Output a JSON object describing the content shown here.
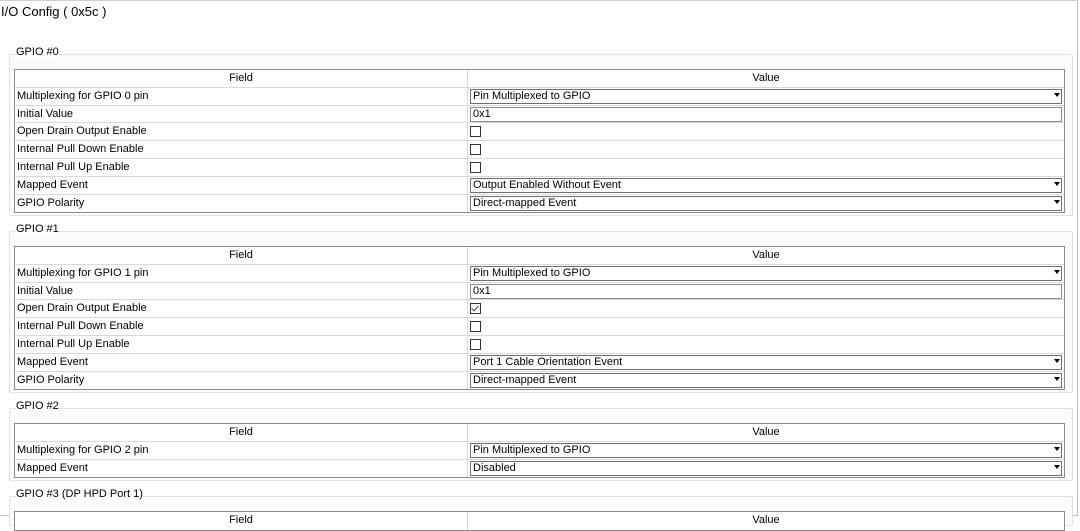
{
  "page": {
    "title": "I/O Config  ( 0x5c )"
  },
  "table_header": {
    "field": "Field",
    "value": "Value"
  },
  "gpio0": {
    "title": "GPIO #0",
    "rows": [
      {
        "label": "Multiplexing for GPIO 0 pin",
        "type": "select",
        "value": "Pin Multiplexed to GPIO"
      },
      {
        "label": "Initial Value",
        "type": "text",
        "value": "0x1"
      },
      {
        "label": "Open Drain Output Enable",
        "type": "checkbox",
        "checked": false
      },
      {
        "label": "Internal Pull Down Enable",
        "type": "checkbox",
        "checked": false
      },
      {
        "label": "Internal Pull Up Enable",
        "type": "checkbox",
        "checked": false
      },
      {
        "label": "Mapped Event",
        "type": "select",
        "value": "Output Enabled Without Event"
      },
      {
        "label": "GPIO Polarity",
        "type": "select",
        "value": "Direct-mapped Event"
      }
    ]
  },
  "gpio1": {
    "title": "GPIO #1",
    "rows": [
      {
        "label": "Multiplexing for GPIO 1 pin",
        "type": "select",
        "value": "Pin Multiplexed to GPIO"
      },
      {
        "label": "Initial Value",
        "type": "text",
        "value": "0x1"
      },
      {
        "label": "Open Drain Output Enable",
        "type": "checkbox",
        "checked": true
      },
      {
        "label": "Internal Pull Down Enable",
        "type": "checkbox",
        "checked": false
      },
      {
        "label": "Internal Pull Up Enable",
        "type": "checkbox",
        "checked": false
      },
      {
        "label": "Mapped Event",
        "type": "select",
        "value": "Port 1 Cable Orientation Event"
      },
      {
        "label": "GPIO Polarity",
        "type": "select",
        "value": "Direct-mapped Event"
      }
    ]
  },
  "gpio2": {
    "title": "GPIO #2",
    "rows": [
      {
        "label": "Multiplexing for GPIO 2 pin",
        "type": "select",
        "value": "Pin Multiplexed to GPIO"
      },
      {
        "label": "Mapped Event",
        "type": "select",
        "value": "Disabled"
      }
    ]
  },
  "gpio3": {
    "title": "GPIO #3 (DP HPD Port 1)"
  }
}
